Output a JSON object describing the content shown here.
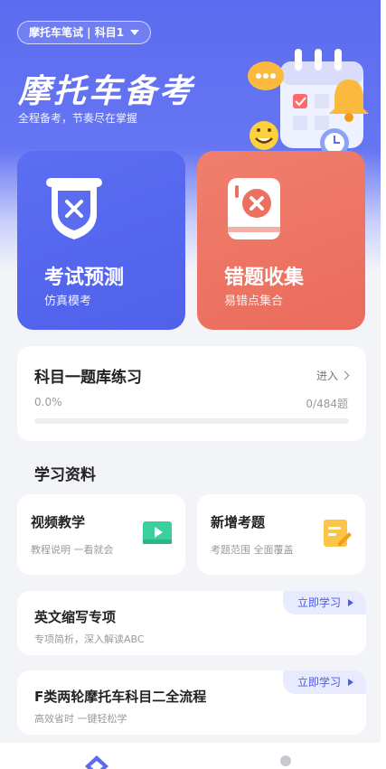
{
  "header": {
    "subject_selector": "摩托车笔试 | 科目1",
    "title": "摩托车备考",
    "subtitle": "全程备考，节奏尽在掌握"
  },
  "cards": {
    "exam": {
      "label": "考试预测",
      "sub": "仿真模考",
      "color": "#5b6cf0"
    },
    "wrong": {
      "label": "错题收集",
      "sub": "易错点集合",
      "color": "#ec705f"
    }
  },
  "question_bank": {
    "title": "科目一题库练习",
    "enter_label": "进入",
    "progress_percent": "0.0%",
    "progress_count": "0/484题",
    "progress_fraction": 0.0
  },
  "materials": {
    "section_title": "学习资料",
    "video": {
      "title": "视频教学",
      "sub": "教程说明 一看就会",
      "icon": "play-video-icon"
    },
    "new_questions": {
      "title": "新增考题",
      "sub": "考题范围 全面覆盖",
      "icon": "edit-note-icon"
    }
  },
  "promos": [
    {
      "title": "英文缩写专项",
      "sub": "专项简析，深入解读ABC",
      "tag": "立即学习"
    },
    {
      "title": "F类两轮摩托车科目二全流程",
      "sub": "高效省时 一键轻松学",
      "tag": "立即学习"
    }
  ],
  "tabbar": {
    "home_icon": "home-diamond-icon",
    "user_icon": "user-icon"
  },
  "colors": {
    "primary": "#5b6cf0",
    "danger": "#ec705f",
    "tag_bg": "#e8ebfd"
  }
}
